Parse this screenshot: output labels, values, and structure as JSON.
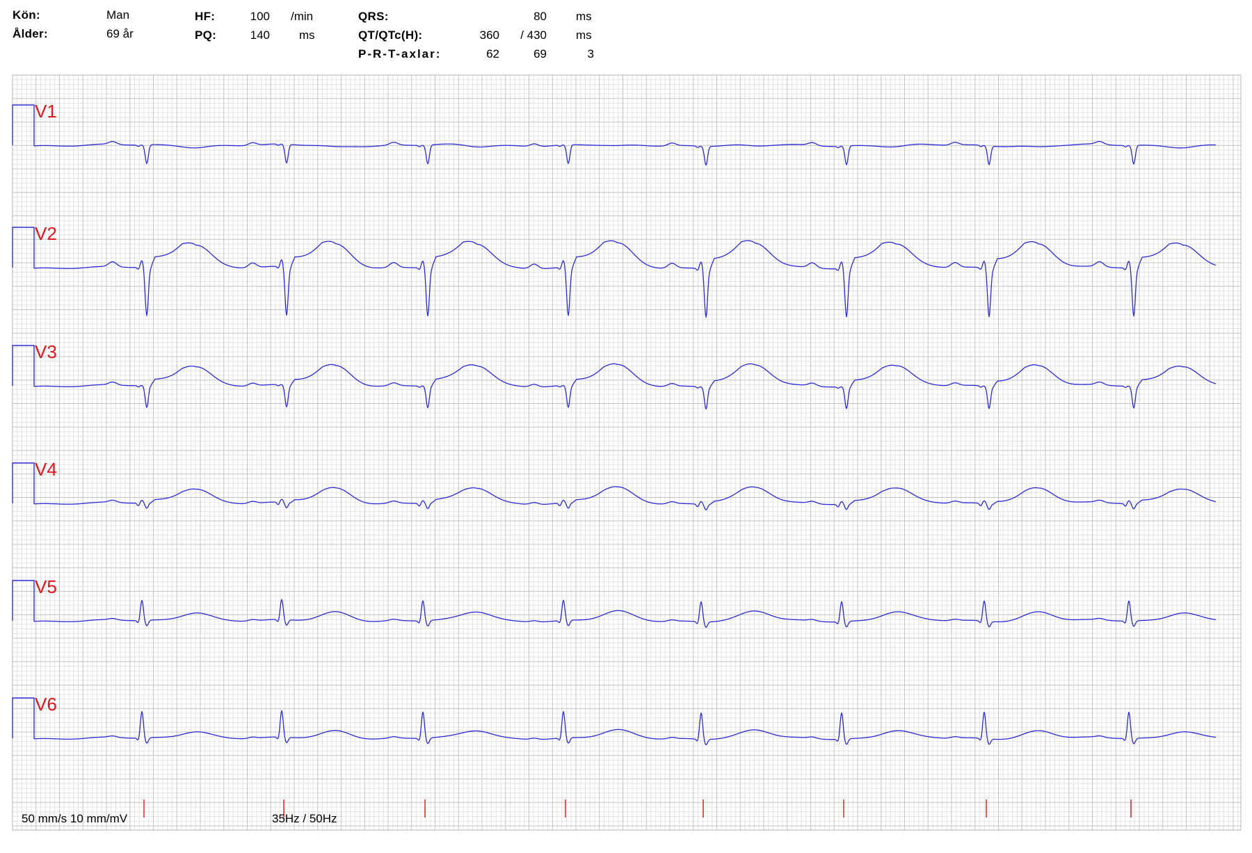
{
  "header": {
    "sex_label": "Kön:",
    "sex_value": "Man",
    "age_label": "Ålder:",
    "age_value": "69 år",
    "hr_label": "HF:",
    "hr_value": "100",
    "hr_unit": "/min",
    "pq_label": "PQ:",
    "pq_value": "140",
    "pq_unit": "ms",
    "qrs_label": "QRS:",
    "qrs_value": "80",
    "qrs_unit": "ms",
    "qt_label": "QT/QTc(H):",
    "qt_value": "360",
    "qtc_value": "/ 430",
    "qt_unit": "ms",
    "axis_label": "P-R-T-axlar:",
    "axis_p": "62",
    "axis_r": "69",
    "axis_t": "3"
  },
  "leads": [
    {
      "name": "V1"
    },
    {
      "name": "V2"
    },
    {
      "name": "V3"
    },
    {
      "name": "V4"
    },
    {
      "name": "V5"
    },
    {
      "name": "V6"
    }
  ],
  "footer": {
    "speed_gain": "50 mm/s 10 mm/mV",
    "filter": "35Hz / 50Hz"
  },
  "colors": {
    "trace": "#2a2ad8",
    "lead_label": "#e0141c",
    "beat_marker": "#e0141c",
    "grid_minor": "#e3e3e3",
    "grid_major": "#c4c4c4"
  }
}
